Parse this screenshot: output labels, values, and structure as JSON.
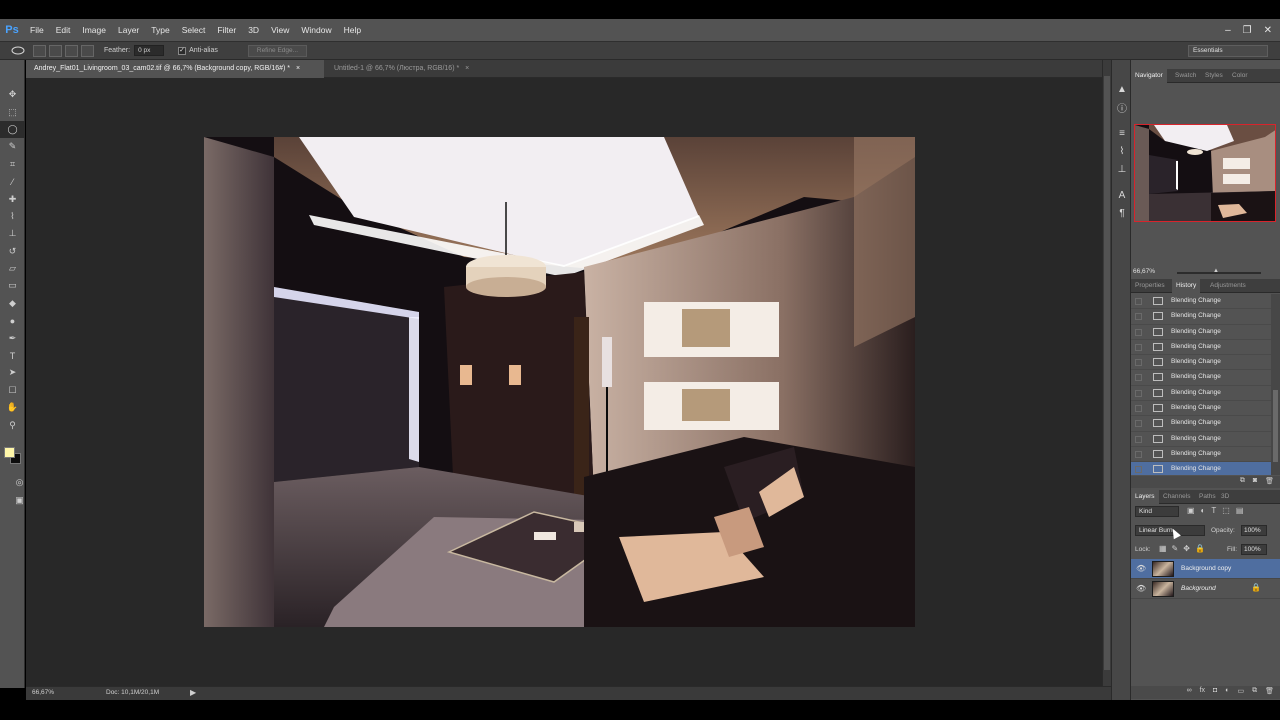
{
  "app": {
    "logo": "Ps"
  },
  "menu": [
    "File",
    "Edit",
    "Image",
    "Layer",
    "Type",
    "Select",
    "Filter",
    "3D",
    "View",
    "Window",
    "Help"
  ],
  "window_controls": [
    "–",
    "❐",
    "✕"
  ],
  "options_bar": {
    "feather_label": "Feather:",
    "feather_value": "0 px",
    "anti_alias_label": "Anti-alias",
    "refine_edge_label": "Refine Edge...",
    "workspace": "Essentials"
  },
  "tabs": [
    {
      "label": "Andrey_Flat01_Livingroom_03_cam02.tif @ 66,7% (Background copy, RGB/16#) *",
      "close": "×"
    },
    {
      "label": "Untitled-1 @ 66,7% (Люстра, RGB/16) *",
      "close": "×"
    }
  ],
  "status": {
    "zoom": "66,67%",
    "doc": "Doc: 10,1M/20,1M",
    "arrow": "▶"
  },
  "swatches": {
    "foreground": "#fff7a9",
    "background": "#0d0d0d"
  },
  "panels": {
    "navigator_tabs": [
      "Navigator",
      "Swatch",
      "Styles",
      "Color"
    ],
    "navigator_zoom": "66,67%",
    "history_tabs": [
      "Properties",
      "History",
      "Adjustments"
    ],
    "history_items": [
      "Blending Change",
      "Blending Change",
      "Blending Change",
      "Blending Change",
      "Blending Change",
      "Blending Change",
      "Blending Change",
      "Blending Change",
      "Blending Change",
      "Blending Change",
      "Blending Change",
      "Blending Change"
    ],
    "layer_tabs": [
      "Layers",
      "Channels",
      "Paths",
      "3D"
    ],
    "kind": "Kind",
    "blend_mode": "Linear Burn",
    "opacity_label": "Opacity:",
    "opacity": "100%",
    "lock_label": "Lock:",
    "fill_label": "Fill:",
    "fill": "100%",
    "layers": [
      {
        "name": "Background copy"
      },
      {
        "name": "Background"
      }
    ]
  }
}
